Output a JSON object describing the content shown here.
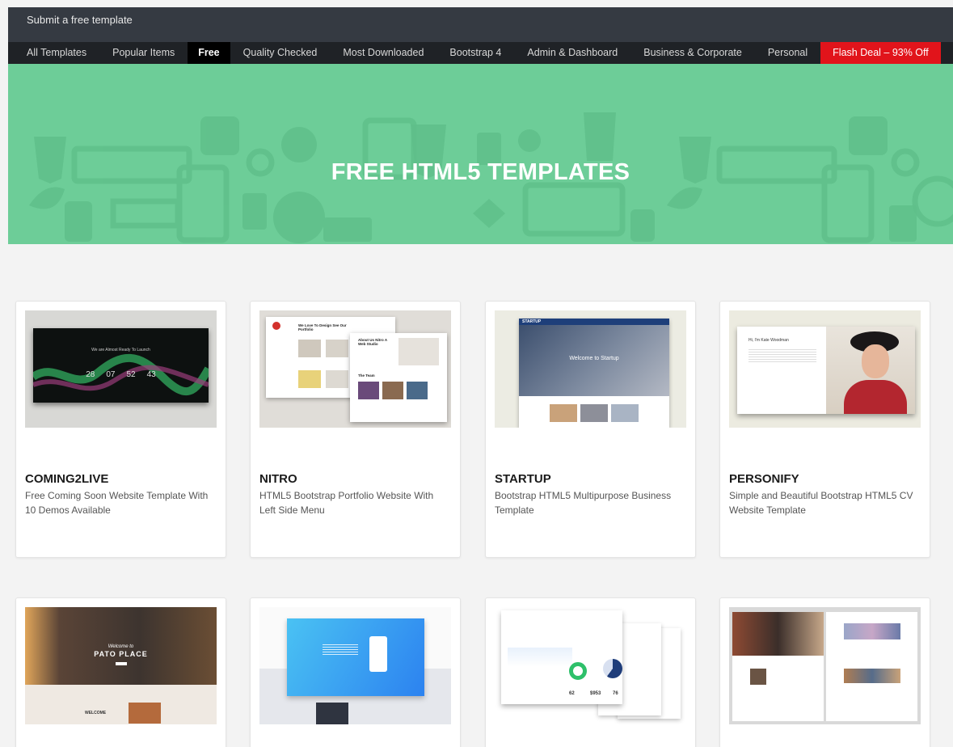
{
  "topbar": {
    "submit_label": "Submit a free template"
  },
  "nav": {
    "items": [
      "All Templates",
      "Popular Items",
      "Free",
      "Quality Checked",
      "Most Downloaded",
      "Bootstrap 4",
      "Admin & Dashboard",
      "Business & Corporate",
      "Personal",
      "Flash Deal – 93% Off"
    ],
    "active": "Free"
  },
  "hero": {
    "title": "FREE HTML5 TEMPLATES",
    "background": "#6dcd98"
  },
  "cards": [
    {
      "title": "COMING2LIVE",
      "desc": "Free Coming Soon Website Template With 10 Demos Available",
      "thumb": {
        "headline": "We are Almost Ready To Launch",
        "countdown": [
          "28",
          "07",
          "52",
          "43"
        ]
      }
    },
    {
      "title": "NITRO",
      "desc": "HTML5 Bootstrap Portfolio Website With Left Side Menu",
      "thumb": {
        "heading1": "We Love To Design See Our Portfolio",
        "heading2": "About Us Nitro A Web Studio",
        "heading3": "The Team"
      }
    },
    {
      "title": "STARTUP",
      "desc": "Bootstrap HTML5 Multipurpose Business Template",
      "thumb": {
        "brand": "STARTUP",
        "headline": "Welcome to Startup"
      }
    },
    {
      "title": "PERSONIFY",
      "desc": "Simple and Beautiful Bootstrap HTML5 CV Website Template",
      "thumb": {
        "headline": "Hi, I'm Kate Woodman"
      }
    },
    {
      "title": "",
      "desc": "",
      "thumb": {
        "line1": "Welcome to",
        "line2": "PATO PLACE",
        "section": "WELCOME"
      }
    },
    {
      "title": "",
      "desc": "",
      "thumb": {}
    },
    {
      "title": "",
      "desc": "",
      "thumb": {
        "stats": [
          "62",
          "$953",
          "76"
        ]
      }
    },
    {
      "title": "",
      "desc": "",
      "thumb": {}
    }
  ]
}
